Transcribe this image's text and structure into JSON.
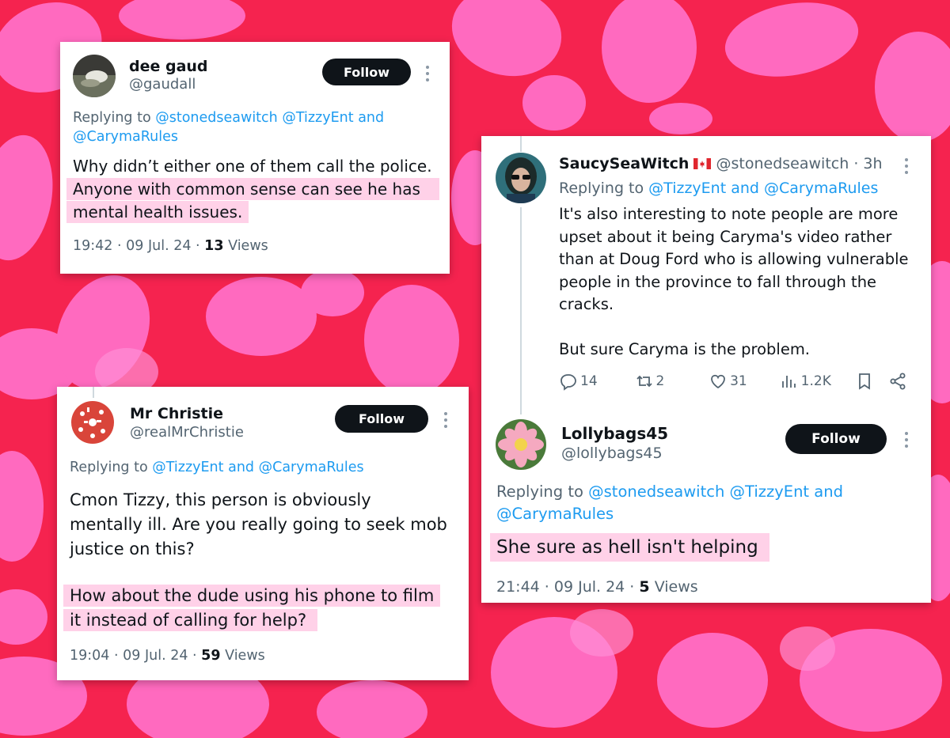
{
  "background_colors": {
    "base": "#f5234f",
    "spots": "#ff6fc6",
    "spots_light": "#ff8fd5"
  },
  "accent_color": "#1d9bf0",
  "cards": {
    "dee": {
      "name": "dee gaud",
      "handle": "@gaudall",
      "follow_label": "Follow",
      "reply_prefix": "Replying to",
      "reply_mention1": "@stonedseawitch",
      "reply_mention2": "@TizzyEnt",
      "reply_and": "and",
      "reply_mention3": "@CarymaRules",
      "line1": "Why didn’t either one of them call the police.",
      "line2": "Anyone with common sense can see he has",
      "line3": "mental health issues.",
      "time": "19:42 · 09 Jul. 24 ·",
      "views_count": "13",
      "views_label": "Views",
      "avatar_icon": "landscape-avatar-icon"
    },
    "christie": {
      "name": "Mr Christie",
      "handle": "@realMrChristie",
      "follow_label": "Follow",
      "reply_prefix": "Replying to",
      "reply_mention1": "@TizzyEnt",
      "reply_and": "and",
      "reply_mention2": "@CarymaRules",
      "line1": "Cmon Tizzy, this person is obviously",
      "line2": "mentally ill. Are you really going to seek mob",
      "line3": "justice on this?",
      "line4": "How about the dude using his phone to film",
      "line5": "it instead of calling for help?",
      "time": "19:04 · 09 Jul. 24 ·",
      "views_count": "59",
      "views_label": "Views",
      "avatar_icon": "red-pattern-avatar-icon"
    },
    "saucy": {
      "name": "SaucySeaWitch",
      "flag_icon": "canada-flag-icon",
      "handle": "@stonedseawitch",
      "age": "· 3h",
      "reply_prefix": "Replying to",
      "reply_mention1": "@TizzyEnt",
      "reply_and": "and",
      "reply_mention2": "@CarymaRules",
      "line1": "It's also interesting to note people are more",
      "line2": "upset about it being Caryma's video rather",
      "line3": "than at Doug Ford who is allowing vulnerable",
      "line4": "people in the province to fall through the",
      "line5": "cracks.",
      "line6": "But sure Caryma is the problem.",
      "replies": "14",
      "reposts": "2",
      "likes": "31",
      "views": "1.2K",
      "avatar_icon": "person-sunglasses-avatar-icon"
    },
    "lolly": {
      "name": "Lollybags45",
      "handle": "@lollybags45",
      "follow_label": "Follow",
      "reply_prefix": "Replying to",
      "reply_mention1": "@stonedseawitch",
      "reply_mention2": "@TizzyEnt",
      "reply_and": "and",
      "reply_mention3": "@CarymaRules",
      "line1": "She sure as hell isn't helping",
      "time": "21:44 · 09 Jul. 24 ·",
      "views_count": "5",
      "views_label": "Views",
      "avatar_icon": "flower-avatar-icon"
    }
  }
}
